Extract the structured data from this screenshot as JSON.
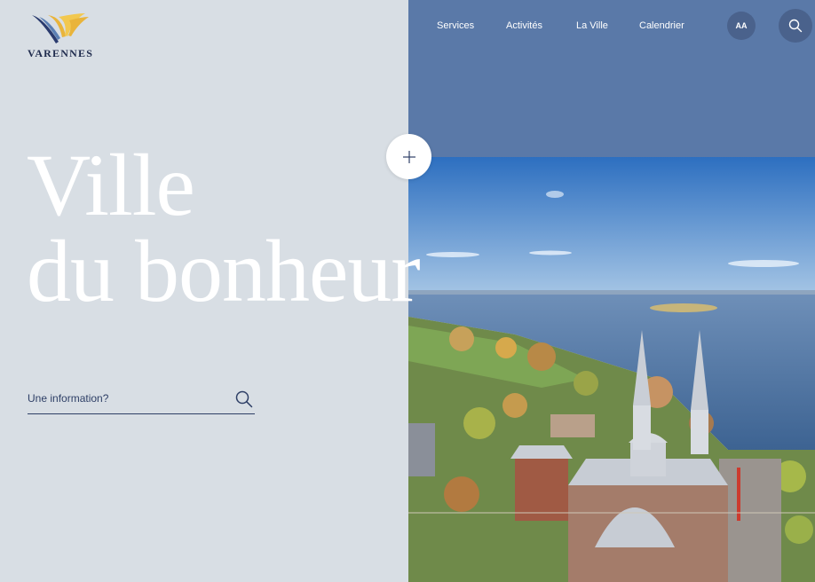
{
  "brand": {
    "name": "VARENNES",
    "logo_colors": [
      "#e9b43b",
      "#f2c84f",
      "#2a3b6e",
      "#5b7fb3"
    ]
  },
  "nav": {
    "items": [
      {
        "label": "Services"
      },
      {
        "label": "Activités"
      },
      {
        "label": "La Ville"
      },
      {
        "label": "Calendrier"
      }
    ],
    "text_size_label": "AA",
    "search_icon": "search-icon"
  },
  "hero": {
    "line1": "Ville",
    "line2": "du bonheur",
    "expand_icon": "plus-icon"
  },
  "search": {
    "placeholder": "Une information?",
    "value": ""
  },
  "colors": {
    "left_panel": "#d8dee4",
    "header_blue": "#5a79a8",
    "button_dark": "#4a628c",
    "text_navy": "#2e3f66",
    "hero_text": "#ffffff"
  },
  "photo": {
    "subject": "aerial-church-river-town"
  }
}
